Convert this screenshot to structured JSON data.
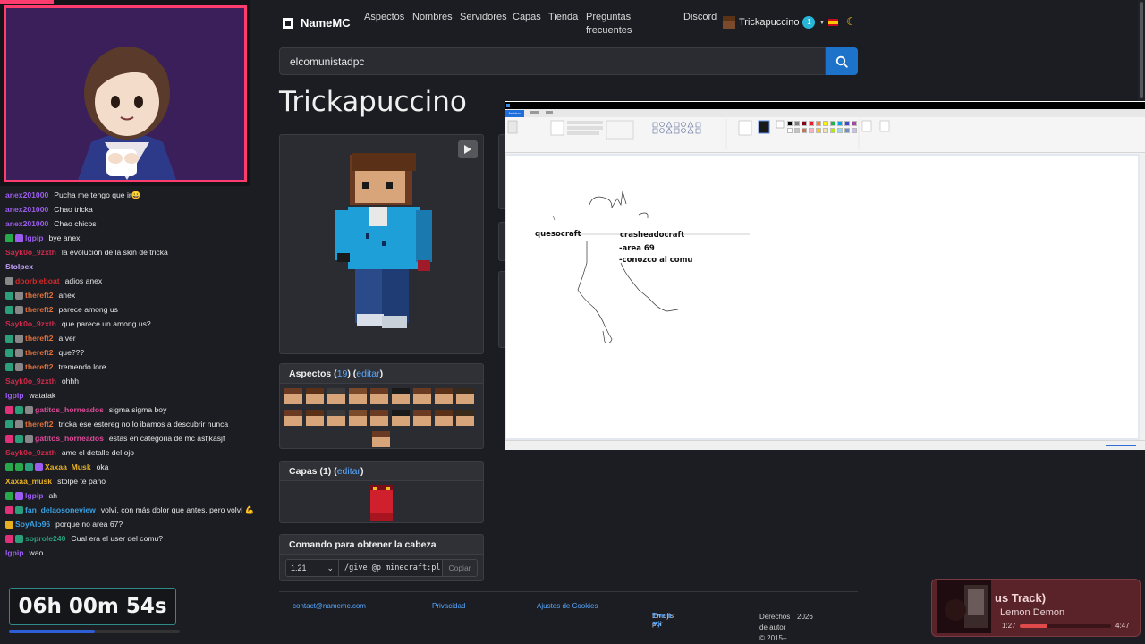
{
  "chat": [
    {
      "user": "anex201000",
      "color": "#9c5cf0",
      "msg": "Pucha me tengo que ir😀",
      "badges": []
    },
    {
      "user": "anex201000",
      "color": "#9c5cf0",
      "msg": "Chao tricka",
      "badges": []
    },
    {
      "user": "anex201000",
      "color": "#9c5cf0",
      "msg": "Chao chicos",
      "badges": []
    },
    {
      "user": "lgpip",
      "color": "#9c5cf0",
      "msg": "bye anex",
      "badges": [
        "#27a84a",
        "#9c5cf0"
      ]
    },
    {
      "user": "Sayk0o_9zxth",
      "color": "#d02a4a",
      "msg": "la evolución de la skin de tricka",
      "badges": []
    },
    {
      "user": "Stolpex",
      "color": "#c6a4ff",
      "msg": "",
      "badges": []
    },
    {
      "user": "doorbleboat",
      "color": "#d02a2a",
      "msg": "adios anex",
      "badges": [
        "#888888"
      ]
    },
    {
      "user": "thereft2",
      "color": "#e0703a",
      "msg": "anex",
      "badges": [
        "#2a9f7a",
        "#888888"
      ]
    },
    {
      "user": "thereft2",
      "color": "#e0703a",
      "msg": "parece among us",
      "badges": [
        "#2a9f7a",
        "#888888"
      ]
    },
    {
      "user": "Sayk0o_9zxth",
      "color": "#d02a4a",
      "msg": "que parece un among us?",
      "badges": []
    },
    {
      "user": "thereft2",
      "color": "#e0703a",
      "msg": "a ver",
      "badges": [
        "#2a9f7a",
        "#888888"
      ]
    },
    {
      "user": "thereft2",
      "color": "#e0703a",
      "msg": "que???",
      "badges": [
        "#2a9f7a",
        "#888888"
      ]
    },
    {
      "user": "thereft2",
      "color": "#e0703a",
      "msg": "tremendo lore",
      "badges": [
        "#2a9f7a",
        "#888888"
      ]
    },
    {
      "user": "Sayk0o_9zxth",
      "color": "#d02a4a",
      "msg": "ohhh",
      "badges": []
    },
    {
      "user": "lgpip",
      "color": "#9c5cf0",
      "msg": "watafak",
      "badges": []
    },
    {
      "user": "gatitos_horneados",
      "color": "#e04a9a",
      "msg": "sigma sigma boy",
      "badges": [
        "#e0307a",
        "#2a9f7a",
        "#888888"
      ]
    },
    {
      "user": "thereft2",
      "color": "#e0703a",
      "msg": "tricka ese estereg no lo ibamos a descubrir nunca",
      "badges": [
        "#2a9f7a",
        "#888888"
      ]
    },
    {
      "user": "gatitos_horneados",
      "color": "#e04a9a",
      "msg": "estas en categoria de mc asfjkasjf",
      "badges": [
        "#e0307a",
        "#2a9f7a",
        "#888888"
      ]
    },
    {
      "user": "Sayk0o_9zxth",
      "color": "#d02a4a",
      "msg": "ame el detalle del ojo",
      "badges": []
    },
    {
      "user": "Xaxaa_Musk",
      "color": "#e8b020",
      "msg": "oka",
      "badges": [
        "#27a84a",
        "#27a84a",
        "#2a9f7a",
        "#9c5cf0"
      ]
    },
    {
      "user": "Xaxaa_musk",
      "color": "#e8b020",
      "msg": "stolpe te paho",
      "badges": []
    },
    {
      "user": "lgpip",
      "color": "#9c5cf0",
      "msg": "ah",
      "badges": [
        "#27a84a",
        "#9c5cf0"
      ]
    },
    {
      "user": "fan_delaosoneview",
      "color": "#3aa0e0",
      "msg": "volví, con más dolor que antes, pero volví 💪",
      "badges": [
        "#e0307a",
        "#2a9f7a"
      ]
    },
    {
      "user": "SoyAlo96",
      "color": "#3aa0e0",
      "msg": "porque no area 67?",
      "badges": [
        "#e8b020"
      ]
    },
    {
      "user": "soprole240",
      "color": "#2a9f7a",
      "msg": "Cual era el user del comu?",
      "badges": [
        "#e0307a",
        "#2a9f7a"
      ]
    },
    {
      "user": "lgpip",
      "color": "#9c5cf0",
      "msg": "wao",
      "badges": []
    }
  ],
  "timer": {
    "text": "06h 00m 54s",
    "progress": 0.5
  },
  "nav": {
    "brand": "NameMC",
    "links": [
      "Aspectos",
      "Nombres",
      "Servidores",
      "Capas",
      "Tienda",
      "Preguntas frecuentes",
      "Discord"
    ],
    "user": "Trickapuccino",
    "notif_count": "1"
  },
  "search": {
    "value": "elcomunistadpc"
  },
  "profile": {
    "title": "Trickapuccino"
  },
  "skins_panel": {
    "label": "Aspectos",
    "count": "19",
    "edit": "editar"
  },
  "capes_panel": {
    "label": "Capas",
    "count": "1",
    "edit": "editar"
  },
  "command_panel": {
    "label": "Comando para obtener la cabeza",
    "version": "1.21",
    "command": "/give @p minecraft:pl",
    "copy": "Copiar"
  },
  "footer": {
    "contact": "contact@namemc.com",
    "privacy": "Privacidad",
    "cookies": "Ajustes de Cookies",
    "emojis": "Emojis por",
    "twemoji": "Twem❤ji",
    "copyright_1": "Derechos de autor © 2015–",
    "copyright_2": "2026"
  },
  "paint": {
    "tab": "Archivo",
    "texts": {
      "q": "quesocraft",
      "c": "crasheadocraft",
      "a": "-area 69",
      "k": "-conozco al comu"
    }
  },
  "now_playing": {
    "title": "us Track)",
    "artist": "Lemon Demon",
    "elapsed": "1:27",
    "total": "4:47",
    "progress": 0.3
  }
}
